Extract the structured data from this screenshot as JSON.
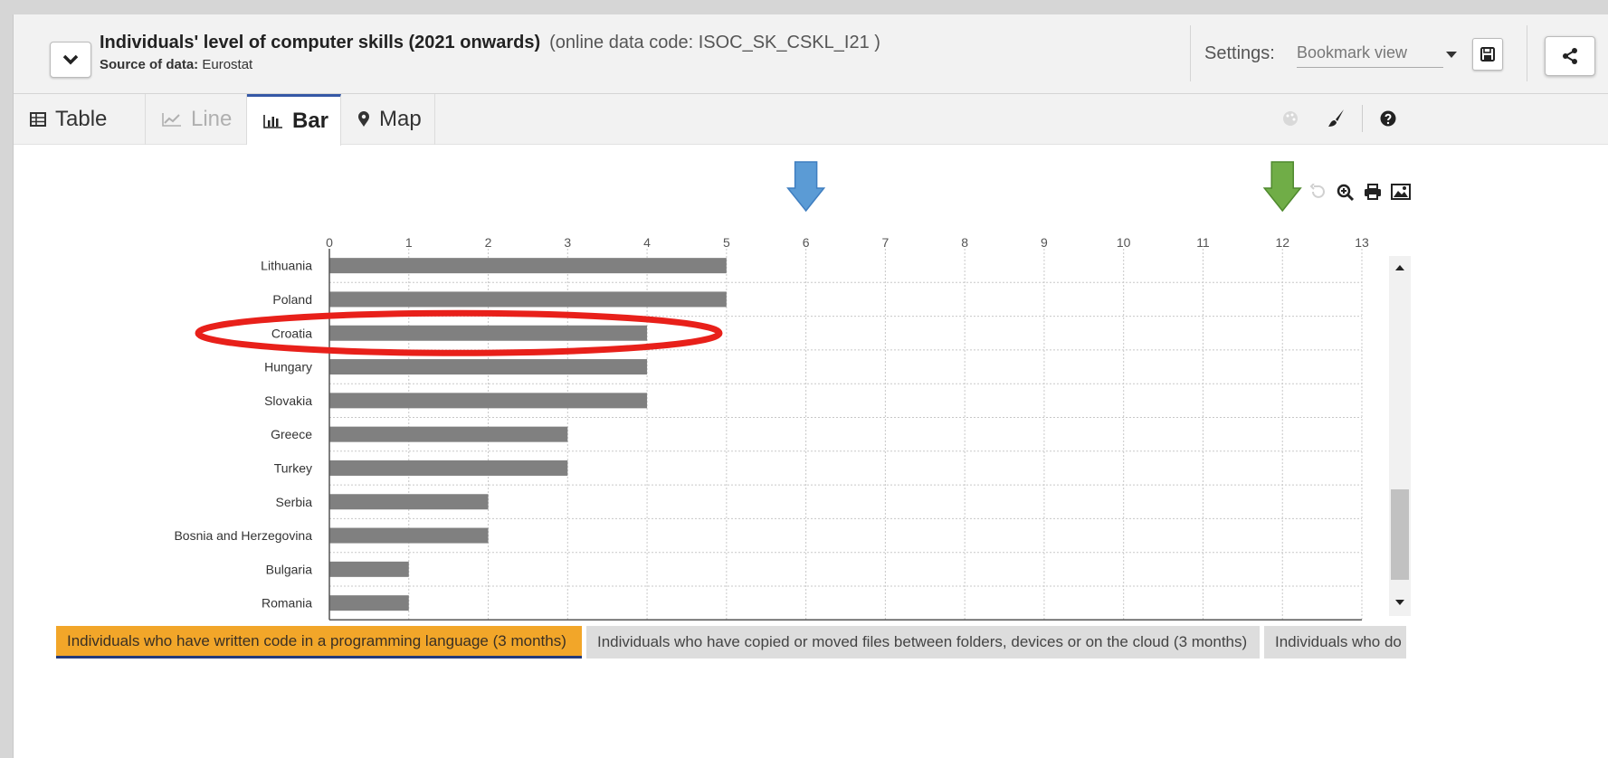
{
  "header": {
    "title": "Individuals' level of computer skills (2021 onwards)",
    "code": "(online data code: ISOC_SK_CSKL_I21 )",
    "source_label": "Source of data:",
    "source_value": "Eurostat",
    "settings_label": "Settings:",
    "settings_value": "Bookmark view"
  },
  "tabs": [
    {
      "label": "Table",
      "icon": "table-icon"
    },
    {
      "label": "Line",
      "icon": "line-chart-icon"
    },
    {
      "label": "Bar",
      "icon": "bar-chart-icon",
      "active": true
    },
    {
      "label": "Map",
      "icon": "map-marker-icon"
    }
  ],
  "chart_data": {
    "type": "bar",
    "orientation": "horizontal",
    "categories": [
      "Lithuania",
      "Poland",
      "Croatia",
      "Hungary",
      "Slovakia",
      "Greece",
      "Turkey",
      "Serbia",
      "Bosnia and Herzegovina",
      "Bulgaria",
      "Romania"
    ],
    "values": [
      5,
      5,
      4,
      4,
      4,
      3,
      3,
      2,
      2,
      1,
      1
    ],
    "xlim": [
      0,
      13
    ],
    "x_ticks": [
      "0",
      "1",
      "2",
      "3",
      "4",
      "5",
      "6",
      "7",
      "8",
      "9",
      "10",
      "11",
      "12",
      "13"
    ],
    "grid": true,
    "bar_color": "#808080",
    "highlight": {
      "category": "Croatia",
      "shape": "red ellipse",
      "color": "#e8201a"
    },
    "annotations": [
      {
        "type": "arrow",
        "direction": "down",
        "color": "#5b9bd5",
        "points_to_x": 6
      },
      {
        "type": "arrow",
        "direction": "down",
        "color": "#70ad47",
        "points_to_x": 12
      }
    ]
  },
  "series_tabs": [
    {
      "label": "Individuals who have written code in a programming language (3 months)",
      "active": true
    },
    {
      "label": "Individuals who have copied or moved files between folders, devices or on the cloud (3 months)"
    },
    {
      "label": "Individuals who do"
    }
  ],
  "colors": {
    "accent": "#3558a6",
    "active_series": "#f2a629",
    "bar": "#808080"
  }
}
